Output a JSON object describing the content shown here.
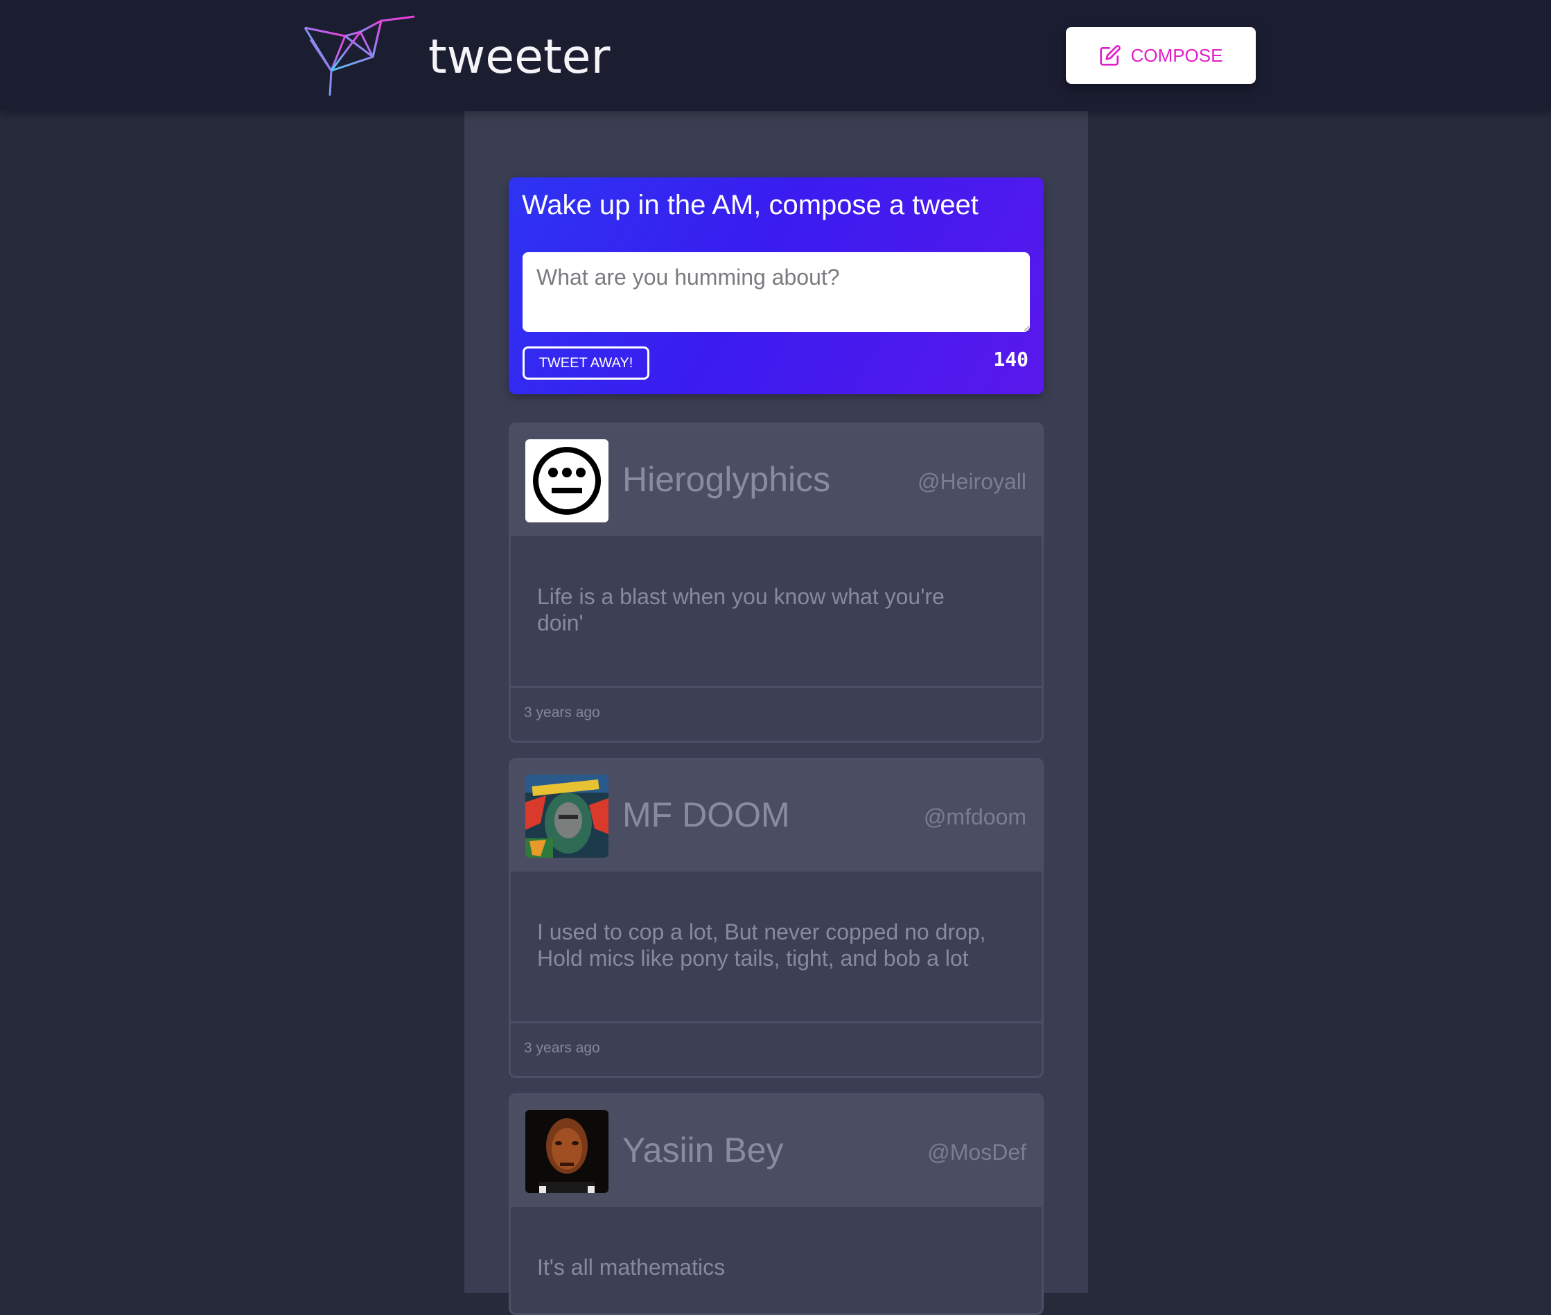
{
  "header": {
    "brand": "tweeter",
    "compose_label": "COMPOSE"
  },
  "compose": {
    "title": "Wake up in the AM, compose a tweet",
    "placeholder": "What are you humming about?",
    "value": "",
    "submit_label": "TWEET AWAY!",
    "counter": "140"
  },
  "tweets": [
    {
      "name": "Hieroglyphics",
      "handle": "@Heiroyall",
      "text": "Life is a blast when you know what you're doin'",
      "time": "3 years ago",
      "avatar": "hiero-face-logo"
    },
    {
      "name": "MF DOOM",
      "handle": "@mfdoom",
      "text": "I used to cop a lot, But never copped no drop, Hold mics like pony tails, tight, and bob a lot",
      "time": "3 years ago",
      "avatar": "doomsday-album-art"
    },
    {
      "name": "Yasiin Bey",
      "handle": "@MosDef",
      "text": "It's all mathematics",
      "time": "",
      "avatar": "portrait-photo"
    }
  ],
  "colors": {
    "navbar": "#1b1d31",
    "page_bg": "#262a3b",
    "column_bg": "#3b3d52",
    "compose_gradient_start": "#2d34f2",
    "compose_gradient_end": "#5a18ec",
    "accent_magenta": "#e01ec8"
  }
}
